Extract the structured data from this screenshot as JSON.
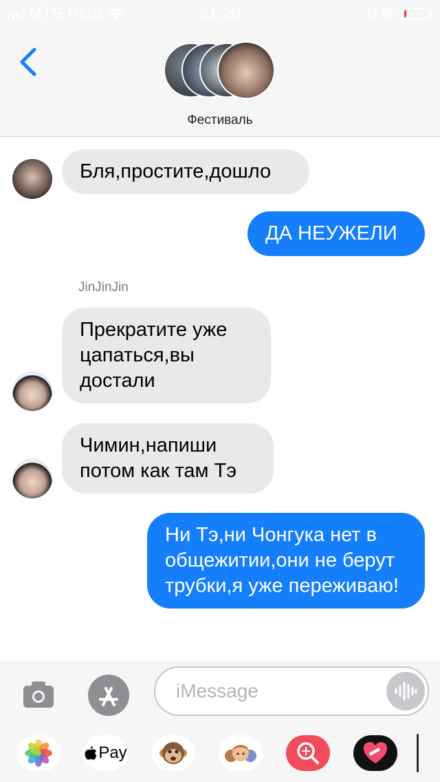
{
  "status_bar": {
    "carrier": "MTS RUS",
    "time": "21:29",
    "battery_percent": "9 %",
    "battery_level": 0.09
  },
  "header": {
    "group_name": "Фестиваль"
  },
  "messages": [
    {
      "direction": "incoming",
      "text": "Бля,простите,дошло"
    },
    {
      "direction": "outgoing",
      "text": "ДА НЕУЖЕЛИ"
    },
    {
      "direction": "incoming",
      "sender": "JinJinJin",
      "text": "Прекратите уже цапаться,вы достали"
    },
    {
      "direction": "incoming",
      "text": "Чимин,напиши потом как там Тэ"
    },
    {
      "direction": "outgoing",
      "text": "Ни Тэ,ни Чонгука нет в общежитии,они не берут трубки,я уже переживаю!"
    }
  ],
  "input": {
    "placeholder": "iMessage"
  },
  "app_drawer": {
    "apple_pay_label": "Pay",
    "apps": [
      "photos-icon",
      "apple-pay-icon",
      "animoji-monkey-icon",
      "memoji-icon",
      "search-images-icon",
      "digital-touch-icon"
    ]
  },
  "colors": {
    "outgoing_bubble": "#147efb",
    "incoming_bubble": "#e9e9eb",
    "accent": "#147efb",
    "battery_low": "#e53c3c"
  }
}
